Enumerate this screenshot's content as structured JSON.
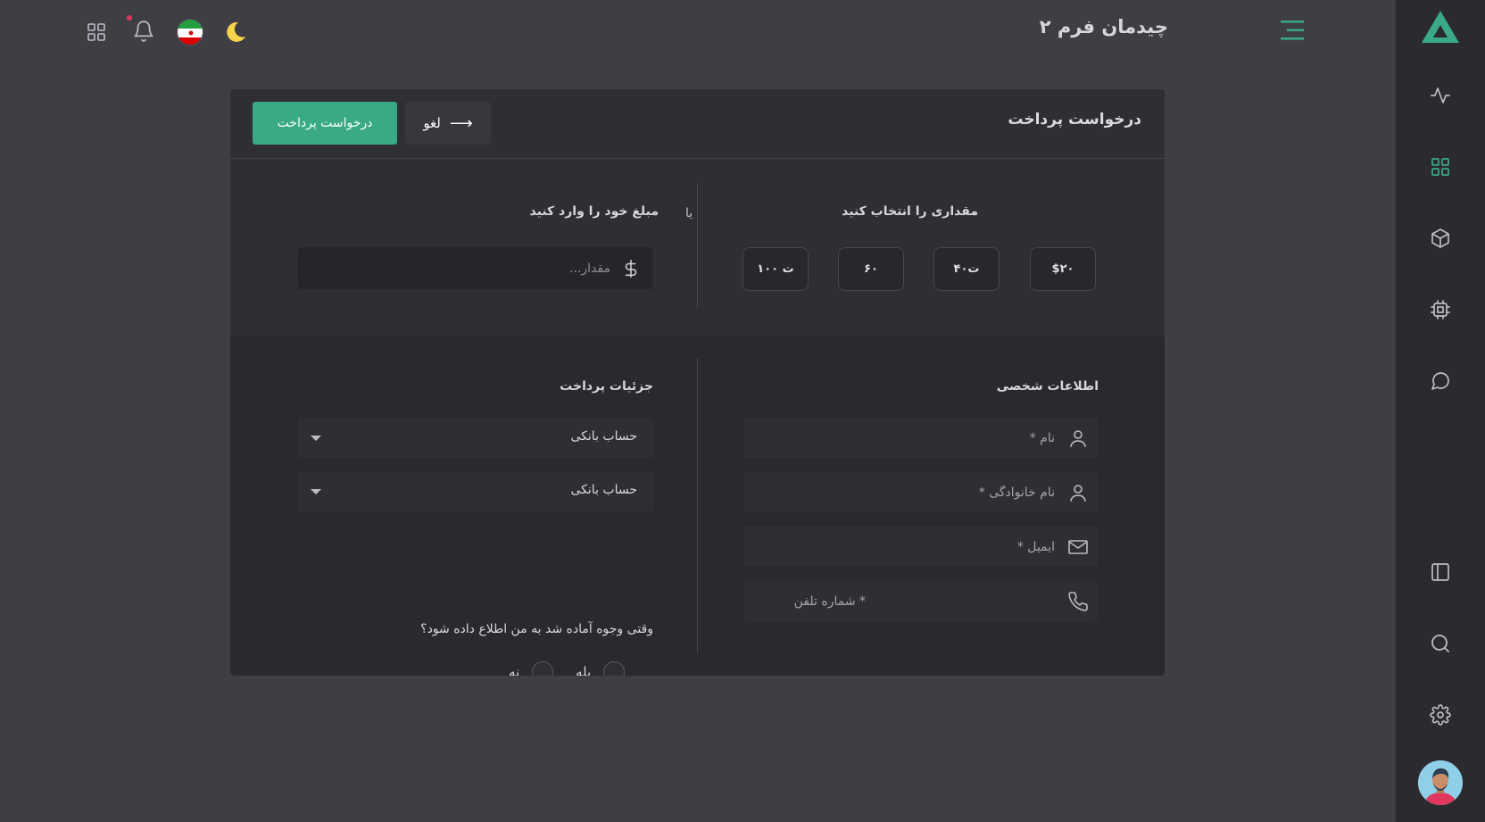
{
  "header": {
    "title": "چیدمان فرم ۲",
    "flag_label": "Iran flag",
    "colors": {
      "accent": "#3aa985",
      "moon": "#f7d44c",
      "notification_dot": "#e0375f"
    }
  },
  "sidebar": {
    "items": [
      {
        "icon": "activity-icon",
        "active": false
      },
      {
        "icon": "grid-icon",
        "active": true
      },
      {
        "icon": "box-icon",
        "active": false
      },
      {
        "icon": "cpu-icon",
        "active": false
      },
      {
        "icon": "chat-icon",
        "active": false
      },
      {
        "icon": "sidebar-panel-icon",
        "active": false
      },
      {
        "icon": "search-icon",
        "active": false
      },
      {
        "icon": "gear-icon",
        "active": false
      }
    ]
  },
  "card": {
    "title": "درخواست پرداخت",
    "submit_label": "درخواست پرداخت",
    "cancel_label": "لغو",
    "cancel_arrow": "⟶",
    "select_amount_label": "مقداری را انتخاب کنید",
    "or_label": "یا",
    "custom_amount_label": "مبلغ خود را وارد کنید",
    "amount_placeholder": "مقدار...",
    "amount_options": [
      "$۲۰",
      "۴۰ت",
      "۶۰",
      "۱۰۰ ت"
    ],
    "personal_info_label": "اطلاعات شخصی",
    "payment_details_label": "جزئیات پرداخت",
    "first_name_placeholder": "نام *",
    "last_name_placeholder": "نام خانوادگی *",
    "email_placeholder": "ایمیل *",
    "phone_placeholder": "* شماره تلفن",
    "select_1_value": "حساب بانکی",
    "select_2_value": "حساب بانکی",
    "notify_question": "وقتی وجوه آماده شد به من اطلاع داده شود؟",
    "radio_yes": "بله",
    "radio_no": "نه"
  }
}
